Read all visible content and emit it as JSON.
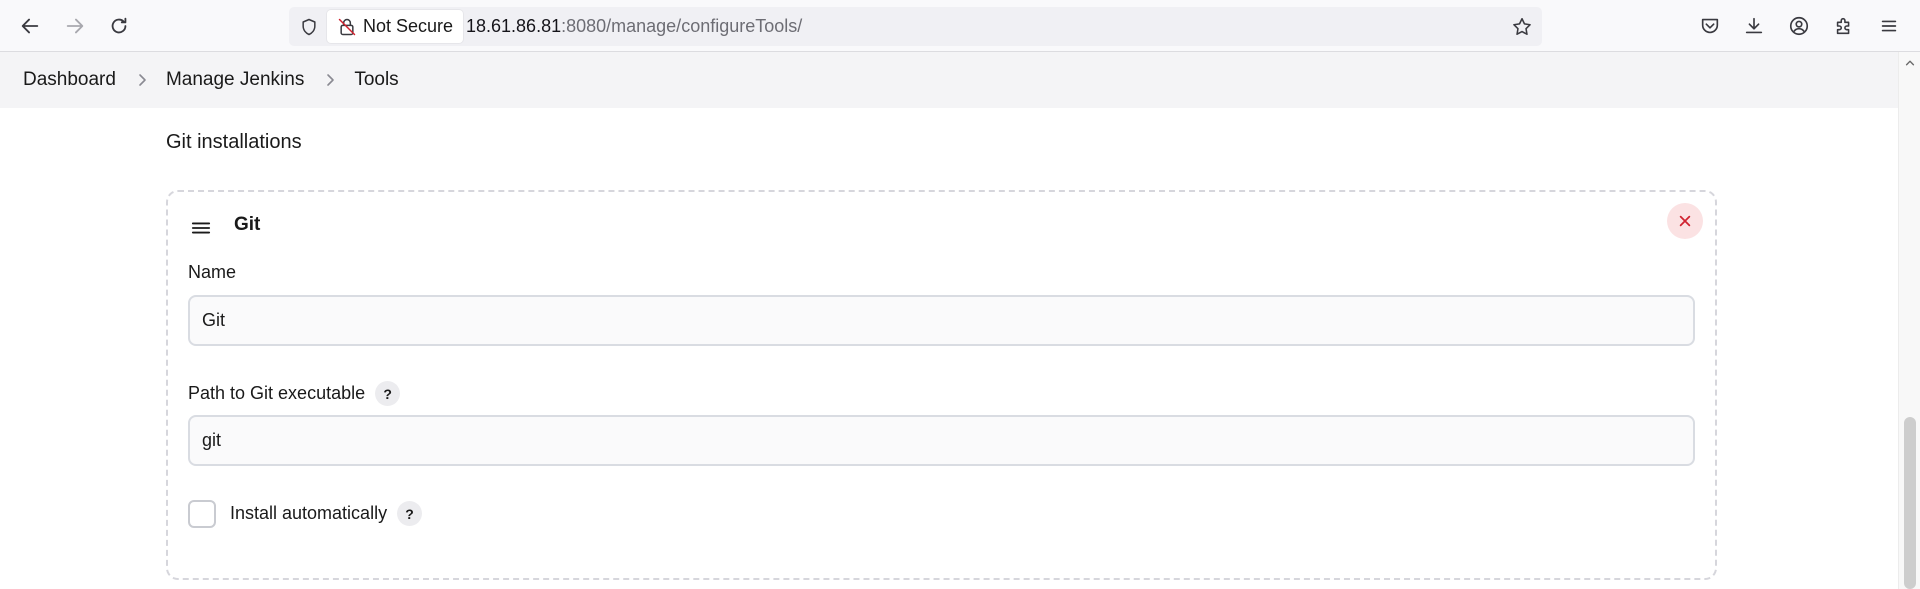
{
  "browser": {
    "security_label": "Not Secure",
    "url_host": "18.61.86.81",
    "url_path": ":8080/manage/configureTools/",
    "icons": [
      "back-icon",
      "forward-icon",
      "reload-icon",
      "shield-icon",
      "insecure-lock-icon",
      "bookmark-star-icon",
      "pocket-icon",
      "downloads-icon",
      "account-icon",
      "extensions-icon",
      "menu-icon"
    ]
  },
  "breadcrumb": {
    "items": [
      {
        "label": "Dashboard"
      },
      {
        "label": "Manage Jenkins"
      },
      {
        "label": "Tools"
      }
    ]
  },
  "section": {
    "title": "Git installations"
  },
  "git_card": {
    "title": "Git",
    "name_label": "Name",
    "name_value": "Git",
    "path_label": "Path to Git executable",
    "path_value": "git",
    "install_label": "Install automatically",
    "install_checked": false,
    "help_glyph": "?"
  },
  "colors": {
    "delete_bg": "#fbe2e3",
    "delete_icon": "#d0222f",
    "card_border": "#d6d6dc"
  }
}
